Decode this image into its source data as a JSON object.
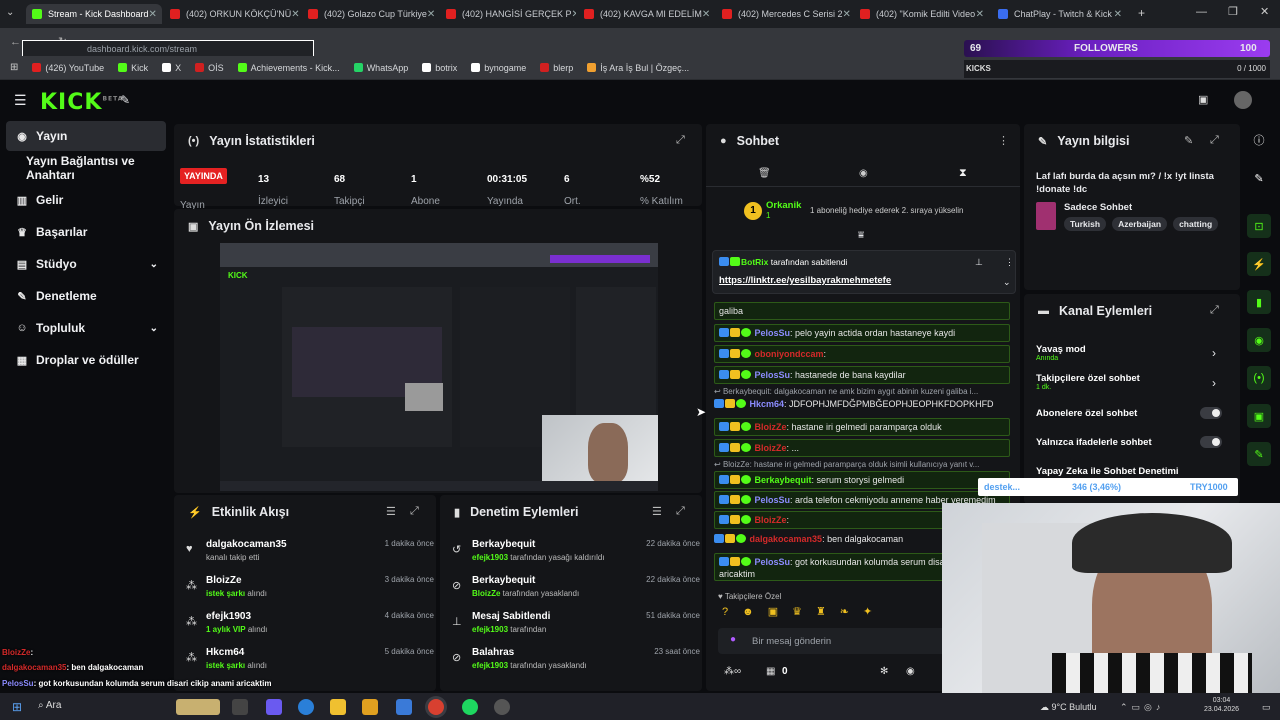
{
  "browser": {
    "tabs": [
      {
        "title": "Stream - Kick Dashboard",
        "color": "#53fc18",
        "active": true
      },
      {
        "title": "(402) ORKUN KÖKÇÜ'NÜ",
        "color": "#e02020"
      },
      {
        "title": "(402) Golazo Cup Türkiye",
        "color": "#e02020"
      },
      {
        "title": "(402) HANGİSİ GERÇEK P",
        "color": "#e02020"
      },
      {
        "title": "(402) KAVGA MI EDELİM",
        "color": "#e02020"
      },
      {
        "title": "(402) Mercedes C Serisi 2",
        "color": "#e02020"
      },
      {
        "title": "(402) \"Komik Edilti Video",
        "color": "#e02020"
      },
      {
        "title": "ChatPlay - Twitch & Kick",
        "color": "#3a6df0"
      }
    ],
    "url": "dashboard.kick.com/stream",
    "bookmarks": [
      {
        "label": "(426) YouTube",
        "color": "#e02020"
      },
      {
        "label": "Kick",
        "color": "#53fc18"
      },
      {
        "label": "X",
        "color": "#ffffff"
      },
      {
        "label": "OİS",
        "color": "#d02020"
      },
      {
        "label": "Achievements - Kick...",
        "color": "#53fc18"
      },
      {
        "label": "WhatsApp",
        "color": "#25d366"
      },
      {
        "label": "botrix",
        "color": "#ffffff"
      },
      {
        "label": "bynogame",
        "color": "#ffffff"
      },
      {
        "label": "blerp",
        "color": "#d02020"
      },
      {
        "label": "İş Ara İş Bul | Özgeç...",
        "color": "#f0a030"
      }
    ]
  },
  "overlay": {
    "follower_count": "69",
    "follower_label": "FOLLOWERS",
    "follower_goal": "100",
    "kicks_label": "KICKS",
    "kicks_value": "0 / 1000",
    "kicks_progress": 0
  },
  "sidebar": {
    "items": [
      {
        "label": "Yayın"
      },
      {
        "label": "Yayın Bağlantısı ve Anahtarı"
      },
      {
        "label": "Gelir"
      },
      {
        "label": "Başarılar"
      },
      {
        "label": "Stüdyo"
      },
      {
        "label": "Denetleme"
      },
      {
        "label": "Topluluk"
      },
      {
        "label": "Droplar ve ödüller"
      }
    ]
  },
  "stats": {
    "title": "Yayın İstatistikleri",
    "live_badge": "YAYINDA",
    "live_label": "Yayın",
    "items": [
      {
        "value": "13",
        "label": "İzleyici"
      },
      {
        "value": "68",
        "label": "Takipçi"
      },
      {
        "value": "1",
        "label": "Abone"
      },
      {
        "value": "00:31:05",
        "label": "Yayında"
      },
      {
        "value": "6",
        "label": "Ort."
      },
      {
        "value": "%52",
        "label": "% Katılım"
      }
    ]
  },
  "preview": {
    "title": "Yayın Ön İzlemesi"
  },
  "activity": {
    "title": "Etkinlik Akışı",
    "items": [
      {
        "name": "dalgakocaman35",
        "desc": "kanalı takip etti",
        "time": "1 dakika önce"
      },
      {
        "name": "BloizZe",
        "desc_pre": "",
        "desc_hl": "istek şarkı",
        "desc_post": " alındı",
        "time": "3 dakika önce"
      },
      {
        "name": "efejk1903",
        "desc_pre": "",
        "desc_hl": "1 aylık VIP",
        "desc_post": " alındı",
        "time": "4 dakika önce"
      },
      {
        "name": "Hkcm64",
        "desc_pre": "",
        "desc_hl": "istek şarkı",
        "desc_post": " alındı",
        "time": "5 dakika önce"
      }
    ]
  },
  "moderation": {
    "title": "Denetim Eylemleri",
    "items": [
      {
        "name": "Berkaybequit",
        "by": "efejk1903",
        "desc": " tarafından yasağı kaldırıldı",
        "time": "22 dakika önce"
      },
      {
        "name": "Berkaybequit",
        "by": "BloizZe",
        "desc": " tarafından yasaklandı",
        "time": "22 dakika önce"
      },
      {
        "name": "Mesaj Sabitlendi",
        "by": "efejk1903",
        "desc": " tarafından",
        "time": "51 dakika önce"
      },
      {
        "name": "Balahras",
        "by": "efejk1903",
        "desc": " tarafından yasaklandı",
        "time": "23 saat önce"
      }
    ]
  },
  "chat": {
    "title": "Sohbet",
    "top_gifter": "Orkanik",
    "top_gifter_count": "1",
    "gift_note": "1 aboneliğ hediye ederek 2. sıraya yükselin",
    "pinned_by": "BotRix",
    "pinned_suffix": " tarafından sabitlendi",
    "pinned_link": "https://linktr.ee/yesilbayrakmehmetefe",
    "messages": [
      {
        "user": "",
        "text": "galiba"
      },
      {
        "user": "PelosSu",
        "text": ": pelo yayin actida ordan hastaneye kaydi"
      },
      {
        "user": "oboniyondccam",
        "text": ":"
      },
      {
        "user": "PelosSu",
        "text": ": hastanede de bana kaydilar"
      },
      {
        "reply": "Berkaybequit: dalgakocaman ne amk bizim aygıt abinin kuzeni galiba i..."
      },
      {
        "user": "Hkcm64",
        "text": ": JDFOPHJMFDĞPMBĞEOPHJEOPHKFDOPKHFD"
      },
      {
        "user": "BloizZe",
        "text": ": hastane iri gelmedi paramparça olduk"
      },
      {
        "user": "BloizZe",
        "text": ": ..."
      },
      {
        "reply": "BloizZe: hastane iri gelmedi paramparça olduk isimli kullanıcıya yanıt v..."
      },
      {
        "user": "Berkaybequit",
        "text": ": serum storysi gelmedi"
      },
      {
        "user": "PelosSu",
        "text": ": arda telefon cekmiyodu anneme haber veremedim"
      },
      {
        "user": "BloizZe",
        "text": ":"
      },
      {
        "user": "dalgakocaman35",
        "text": ": ben dalgakocaman"
      },
      {
        "user": "PelosSu",
        "text": ": got korkusundan kolumda serum disari",
        "text2": "aricaktim"
      }
    ],
    "followers_only": "Takipçilere Özel",
    "input_placeholder": "Bir mesaj gönderin",
    "viewer_count": "0"
  },
  "stream_info": {
    "title": "Yayın bilgisi",
    "stream_title": "Laf lafı burda da açsın mı? / !x !yt linsta !donate !dc",
    "category": "Sadece Sohbet",
    "tags": [
      "Turkish",
      "Azerbaijan",
      "chatting"
    ]
  },
  "channel_actions": {
    "title": "Kanal Eylemleri",
    "items": [
      {
        "label": "Yavaş mod",
        "sub": "Anında"
      },
      {
        "label": "Takipçilere özel sohbet",
        "sub": "1 dk."
      },
      {
        "label": "Abonelere özel sohbet",
        "sub": ""
      },
      {
        "label": "Yalnızca ifadelerle sohbet",
        "sub": ""
      },
      {
        "label": "Yapay Zeka ile Sohbet Denetimi",
        "sub": ""
      }
    ]
  },
  "donation_bar": {
    "label": "destek...",
    "value": "346 (3,46%)",
    "code": "TRY1000"
  },
  "stream_overlay_chat": [
    {
      "user": "BloizZe",
      "text": ":"
    },
    {
      "user": "dalgakocaman35",
      "text": ": ben dalgakocaman"
    },
    {
      "user": "PelosSu",
      "text": ": got korkusundan kolumda serum disari cikip anami aricaktim"
    }
  ],
  "taskbar": {
    "search": "Ara",
    "weather": "9°C Bulutlu",
    "time": "03:04",
    "date": "23.04.2026"
  }
}
